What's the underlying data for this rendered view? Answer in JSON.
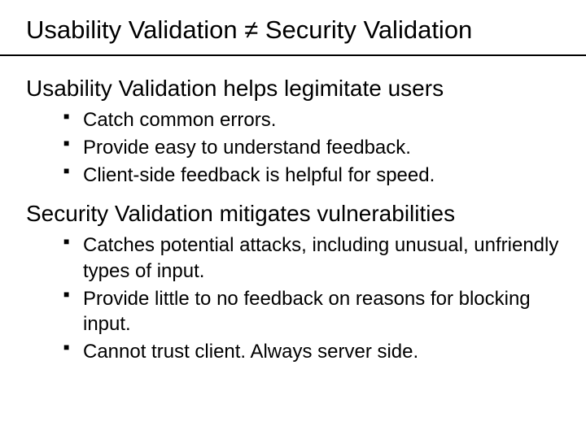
{
  "title": "Usability Validation ≠ Security Validation",
  "section1": {
    "heading": "Usability Validation helps legimitate users",
    "items": [
      "Catch common errors.",
      "Provide easy to understand feedback.",
      "Client-side feedback is helpful for speed."
    ]
  },
  "section2": {
    "heading": "Security Validation mitigates vulnerabilities",
    "items": [
      "Catches potential attacks, including unusual, unfriendly types of input.",
      "Provide little to no feedback on reasons for blocking input.",
      "Cannot trust client.  Always server side."
    ]
  }
}
